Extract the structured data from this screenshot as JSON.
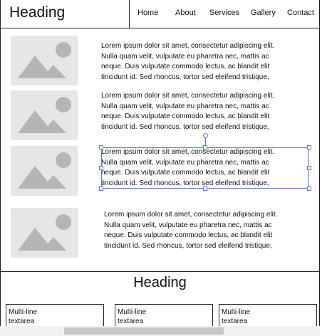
{
  "header": {
    "heading": "Heading",
    "nav": [
      "Home",
      "About",
      "Services",
      "Gallery",
      "Contact"
    ]
  },
  "content": {
    "rows": [
      {
        "lines": [
          "Lorem ipsum dolor sit amet, consectetur adipiscing elit.",
          "Nulla quam velit, vulputate eu pharetra nec, mattis ac",
          "neque. Duis vulputate commodo lectus, ac blandit elit",
          "tincidunt id. Sed rhoncus, tortor sed eleifend tristique,"
        ]
      },
      {
        "lines": [
          "Lorem ipsum dolor sit amet, consectetur adipiscing elit.",
          "Nulla quam velit, vulputate eu pharetra nec, mattis ac",
          "neque. Duis vulputate commodo lectus, ac blandit elit",
          "tincidunt id. Sed rhoncus, tortor sed eleifend tristique,"
        ]
      },
      {
        "lines": [
          "Lorem ipsum dolor sit amet, consectetur adipiscing elit.",
          "Nulla quam velit, vulputate eu pharetra nec, mattis ac",
          "neque. Duis vulputate commodo lectus, ac blandit elit",
          "tincidunt id. Sed rhoncus, tortor sed eleifend tristique,"
        ]
      },
      {
        "lines": [
          "Lorem ipsum dolor sit amet, consectetur adipiscing elit.",
          "Nulla quam velit, vulputate eu pharetra nec, mattis ac",
          "neque. Duis vulputate commodo lectus, ac blandit elit",
          "tincidunt id. Sed rhoncus, tortor sed eleifend tristique,"
        ]
      }
    ],
    "image_icon": "image-placeholder-icon"
  },
  "section2": {
    "heading": "Heading",
    "textareas": [
      {
        "line1": "Multi-line",
        "line2": "textarea"
      },
      {
        "line1": "Multi-line",
        "line2": "textarea"
      },
      {
        "line1": "Multi-line",
        "line2": "textarea"
      }
    ]
  },
  "colors": {
    "selection": "#5b74d8",
    "placeholder_bg": "#e6e6e6",
    "placeholder_fg": "#b5b5b5"
  }
}
